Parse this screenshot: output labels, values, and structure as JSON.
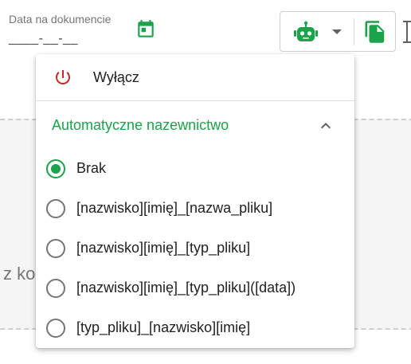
{
  "date_field": {
    "label": "Data na dokumencie",
    "value": "____-__-__",
    "icon": "calendar-icon"
  },
  "toolbar": {
    "robot_icon": "robot-icon",
    "caret_icon": "caret-down-icon",
    "copy_icon": "file-copy-icon"
  },
  "background": {
    "drop_text": "z ko"
  },
  "menu": {
    "off_label": "Wyłącz",
    "off_icon": "power-icon",
    "section_title": "Automatyczne nazewnictwo",
    "section_icon": "chevron-up-icon",
    "options": [
      {
        "label": "Brak",
        "selected": true
      },
      {
        "label": "[nazwisko][imię]_[nazwa_pliku]",
        "selected": false
      },
      {
        "label": "[nazwisko][imię]_[typ_pliku]",
        "selected": false
      },
      {
        "label": "[nazwisko][imię]_[typ_pliku]([data])",
        "selected": false
      },
      {
        "label": "[typ_pliku]_[nazwisko][imię]",
        "selected": false
      }
    ]
  },
  "colors": {
    "accent_green": "#1aa34a",
    "power_red": "#c62828",
    "icon_gray": "#616161"
  }
}
